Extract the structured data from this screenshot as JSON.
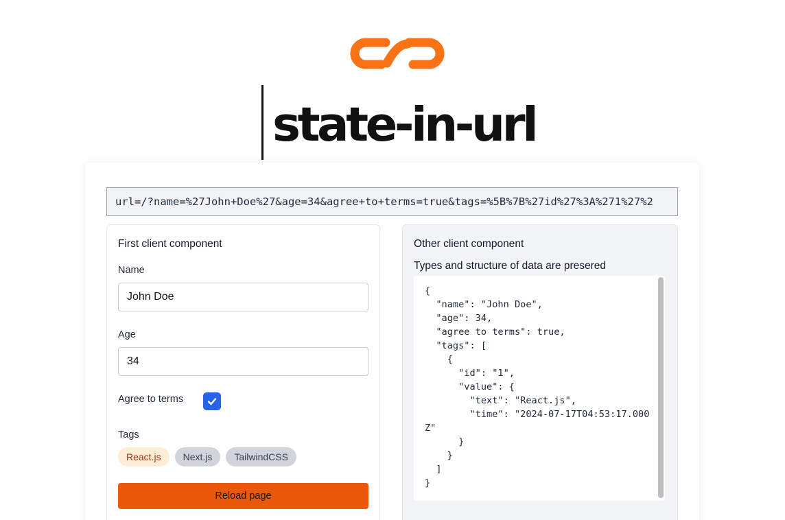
{
  "header": {
    "logo_icon": "chain-link-icon",
    "title": "state-in-url",
    "accent_color": "#f97316"
  },
  "url_bar": {
    "value": "url=/?name=%27John+Doe%27&age=34&agree+to+terms=true&tags=%5B%7B%27id%27%3A%271%27%2"
  },
  "left_panel": {
    "heading": "First client component",
    "name_label": "Name",
    "name_value": "John Doe",
    "age_label": "Age",
    "age_value": "34",
    "agree_label": "Agree to terms",
    "agree_checked": true,
    "tags_label": "Tags",
    "tags": [
      {
        "label": "React.js",
        "selected": true
      },
      {
        "label": "Next.js",
        "selected": false
      },
      {
        "label": "TailwindCSS",
        "selected": false
      }
    ],
    "reload_label": "Reload page"
  },
  "right_panel": {
    "heading": "Other client component",
    "subheading": "Types and structure of data are presered",
    "code": "{\n  \"name\": \"John Doe\",\n  \"age\": 34,\n  \"agree to terms\": true,\n  \"tags\": [\n    {\n      \"id\": \"1\",\n      \"value\": {\n        \"text\": \"React.js\",\n        \"time\": \"2024-07-17T04:53:17.000Z\"\n      }\n    }\n  ]\n}"
  },
  "colors": {
    "primary_button": "#ea580c",
    "checkbox": "#2563eb",
    "active_tag_bg": "#ffedd5",
    "inactive_tag_bg": "#d1d5db"
  }
}
